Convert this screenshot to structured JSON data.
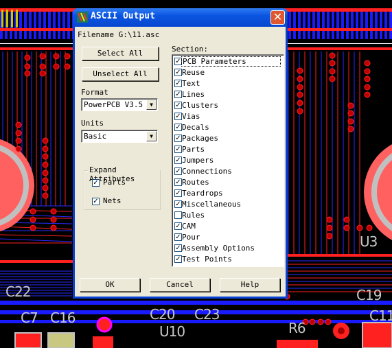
{
  "dialog": {
    "title": "ASCII Output",
    "close_label": "✕",
    "filename_label": "Filename G:\\11.asc",
    "select_all_label": "Select All",
    "unselect_all_label": "Unselect All",
    "format": {
      "label": "Format",
      "value": "PowerPCB V3.5"
    },
    "units": {
      "label": "Units",
      "value": "Basic"
    },
    "expand_attributes": {
      "title": "Expand Attributes",
      "parts": {
        "label": "Parts",
        "checked": true
      },
      "nets": {
        "label": "Nets",
        "checked": true
      }
    },
    "sections": {
      "label": "Section:",
      "items": [
        {
          "label": "PCB Parameters",
          "checked": true,
          "focused": true
        },
        {
          "label": "Reuse",
          "checked": true
        },
        {
          "label": "Text",
          "checked": true
        },
        {
          "label": "Lines",
          "checked": true
        },
        {
          "label": "Clusters",
          "checked": true
        },
        {
          "label": "Vias",
          "checked": true
        },
        {
          "label": "Decals",
          "checked": true
        },
        {
          "label": "Packages",
          "checked": true
        },
        {
          "label": "Parts",
          "checked": true
        },
        {
          "label": "Jumpers",
          "checked": true
        },
        {
          "label": "Connections",
          "checked": true
        },
        {
          "label": "Routes",
          "checked": true
        },
        {
          "label": "Teardrops",
          "checked": true
        },
        {
          "label": "Miscellaneous",
          "checked": true
        },
        {
          "label": "Rules",
          "checked": false
        },
        {
          "label": "CAM",
          "checked": true
        },
        {
          "label": "Pour",
          "checked": true
        },
        {
          "label": "Assembly Options",
          "checked": true
        },
        {
          "label": "Test Points",
          "checked": true
        }
      ]
    },
    "ok_label": "OK",
    "cancel_label": "Cancel",
    "help_label": "Help"
  },
  "pcb_labels": {
    "c22": "C22",
    "c7": "C7",
    "c16": "C16",
    "c20": "C20",
    "c23": "C23",
    "u10": "U10",
    "r6": "R6",
    "c19": "C19",
    "c11": "C11",
    "u3": "U3"
  },
  "colors": {
    "top_layer": "#ff0000",
    "bottom_layer": "#0000ff",
    "silkscreen": "#c8c8c8",
    "board": "#000000",
    "titlebar": "#0a55e0",
    "dialog_face": "#ece9d8"
  }
}
